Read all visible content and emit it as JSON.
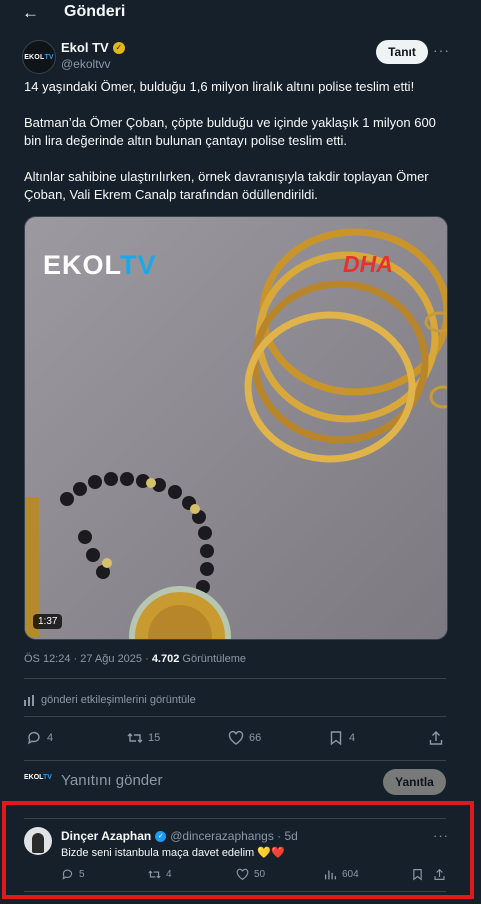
{
  "header": {
    "back_icon": "arrow-left-icon",
    "title": "Gönderi"
  },
  "tweet": {
    "author_name": "Ekol TV",
    "author_handle": "@ekoltvv",
    "avatar_text": {
      "part1": "EKOL",
      "part2": "TV"
    },
    "follow_label": "Tanıt",
    "paragraphs": [
      "14 yaşındaki Ömer, bulduğu 1,6 milyon liralık altını polise teslim etti!",
      "Batman’da Ömer Çoban, çöpte bulduğu ve içinde yaklaşık 1 milyon 600 bin lira değerinde altın bulunan çantayı polise teslim etti.",
      "Altınlar sahibine ulaştırılırken, örnek davranışıyla takdir toplayan Ömer Çoban, Vali Ekrem Canalp tarafından ödüllendirildi."
    ],
    "media": {
      "watermark_left_a": "EKOL",
      "watermark_left_b": "TV",
      "watermark_right": "DHA",
      "duration": "1:37"
    },
    "timestamp": "ÖS 12:24 · 27 Ağu 2025 · ",
    "views_count": "4.702",
    "views_label": " Görüntüleme",
    "analytics_label": "gönderi etkileşimlerini görüntüle",
    "stats": {
      "replies": "4",
      "retweets": "15",
      "likes": "66",
      "bookmarks": "4"
    }
  },
  "reply_composer": {
    "avatar_text": {
      "part1": "EKOL",
      "part2": "TV"
    },
    "placeholder": "Yanıtını gönder",
    "button_label": "Yanıtla"
  },
  "reply": {
    "author_name": "Dinçer Azaphan",
    "author_handle": "@dincerazaphangs · 5d",
    "text": "Bizde seni istanbula maça davet edelim 💛❤️",
    "stats": {
      "replies": "5",
      "retweets": "4",
      "likes": "50",
      "views": "604"
    }
  },
  "colors": {
    "background": "#15202b",
    "accent": "#1d9bf0",
    "muted": "#8b98a5",
    "highlight_box": "#e0191b"
  }
}
